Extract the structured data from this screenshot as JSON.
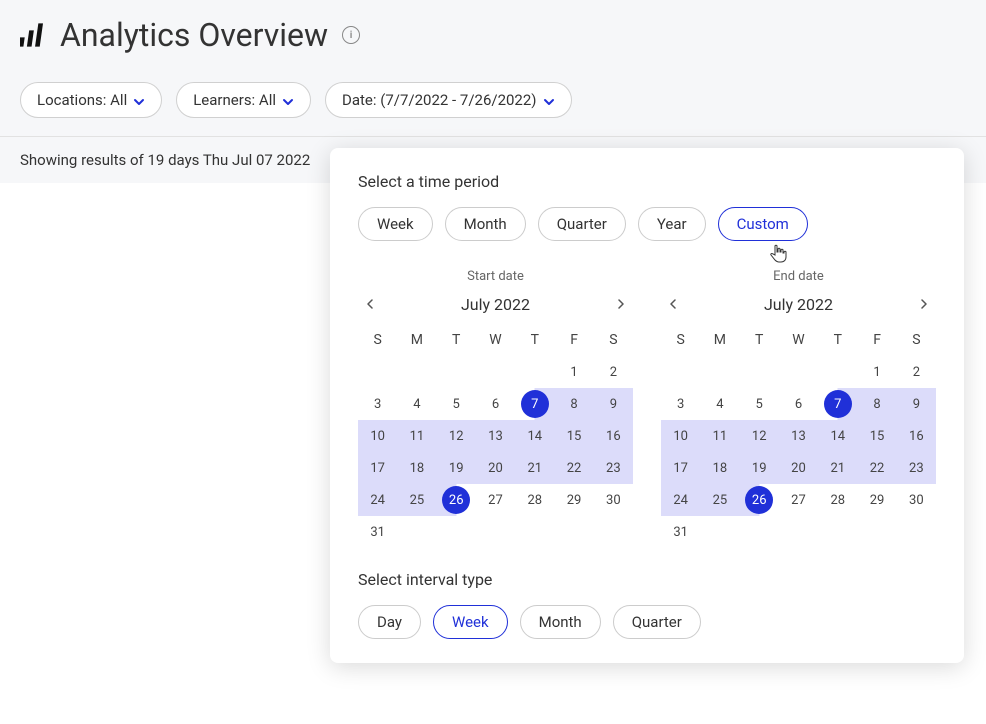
{
  "page": {
    "title": "Analytics Overview"
  },
  "filters": {
    "locations": "Locations: All",
    "learners": "Learners: All",
    "date": "Date: (7/7/2022 - 7/26/2022)"
  },
  "results_text": "Showing results of 19 days Thu Jul 07 2022",
  "popover": {
    "time_period_label": "Select a time period",
    "periods": {
      "week": "Week",
      "month": "Month",
      "quarter": "Quarter",
      "year": "Year",
      "custom": "Custom"
    },
    "start_cal": {
      "label": "Start date",
      "month_year": "July 2022"
    },
    "end_cal": {
      "label": "End date",
      "month_year": "July 2022"
    },
    "weekdays": {
      "0": "S",
      "1": "M",
      "2": "T",
      "3": "W",
      "4": "T",
      "5": "F",
      "6": "S"
    },
    "interval_label": "Select interval type",
    "intervals": {
      "day": "Day",
      "week": "Week",
      "month": "Month",
      "quarter": "Quarter"
    },
    "selected_start": 7,
    "selected_end": 26
  }
}
